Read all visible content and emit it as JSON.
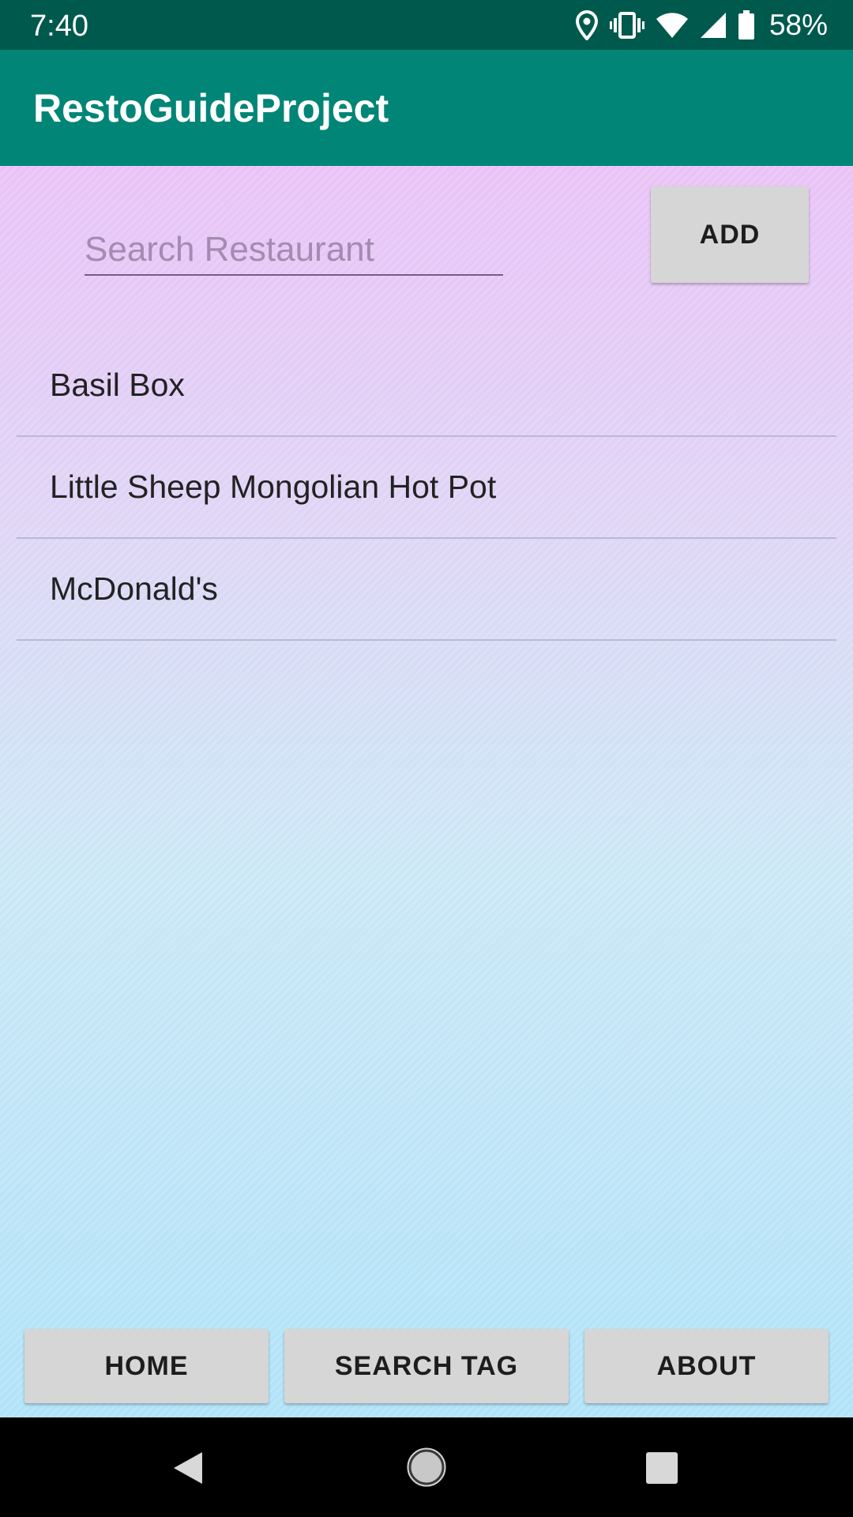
{
  "status_bar": {
    "time": "7:40",
    "battery": "58%",
    "icons": [
      "location-icon",
      "vibrate-icon",
      "wifi-icon",
      "signal-icon",
      "battery-icon"
    ]
  },
  "app_bar": {
    "title": "RestoGuideProject"
  },
  "search": {
    "placeholder": "Search Restaurant",
    "value": ""
  },
  "add_button": {
    "label": "ADD"
  },
  "restaurants": [
    "Basil Box",
    "Little Sheep Mongolian Hot Pot",
    "McDonald's"
  ],
  "bottom_buttons": {
    "home": "HOME",
    "search_tag": "SEARCH TAG",
    "about": "ABOUT"
  },
  "nav_bar": {
    "icons": [
      "back-icon",
      "home-circle-icon",
      "recents-icon"
    ]
  },
  "colors": {
    "status_bar": "#00594d",
    "app_bar": "#008577",
    "button": "#d6d6d6"
  }
}
